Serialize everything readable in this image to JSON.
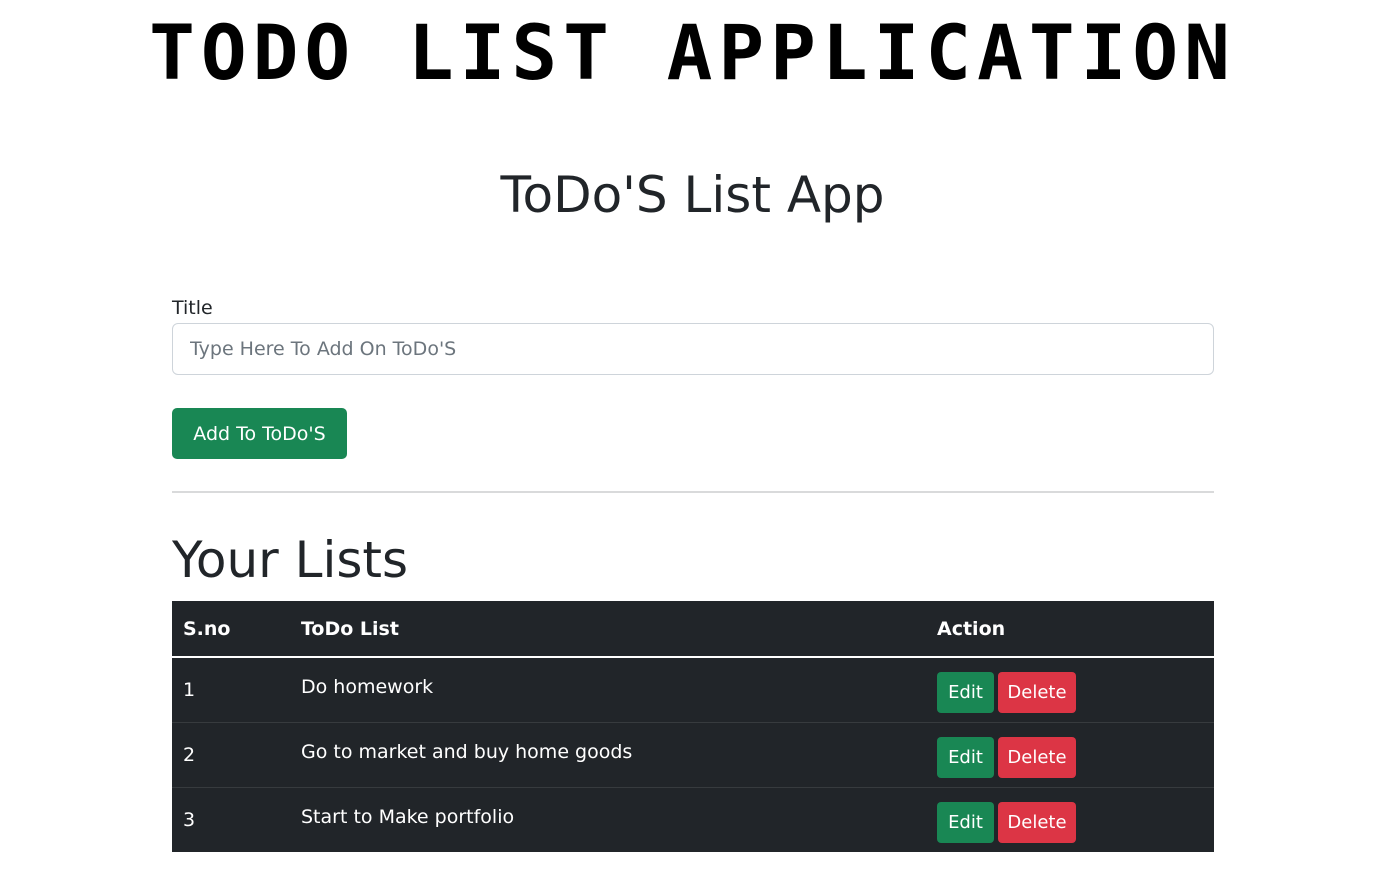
{
  "banner": {
    "text": "Todo List Application"
  },
  "app": {
    "title": "ToDo'S List App"
  },
  "form": {
    "label": "Title",
    "input_value": "",
    "input_placeholder": "Type Here To Add On ToDo'S",
    "add_label": "Add To ToDo'S"
  },
  "lists": {
    "heading": "Your Lists",
    "columns": [
      "S.no",
      "ToDo List",
      "Action"
    ],
    "rows": [
      {
        "sno": "1",
        "title": "Do homework",
        "edit_label": "Edit",
        "delete_label": "Delete"
      },
      {
        "sno": "2",
        "title": "Go to market and buy home goods",
        "edit_label": "Edit",
        "delete_label": "Delete"
      },
      {
        "sno": "3",
        "title": "Start to Make portfolio",
        "edit_label": "Edit",
        "delete_label": "Delete"
      }
    ]
  },
  "colors": {
    "success": "#198754",
    "danger": "#dc3545",
    "table_dark": "#212529"
  }
}
